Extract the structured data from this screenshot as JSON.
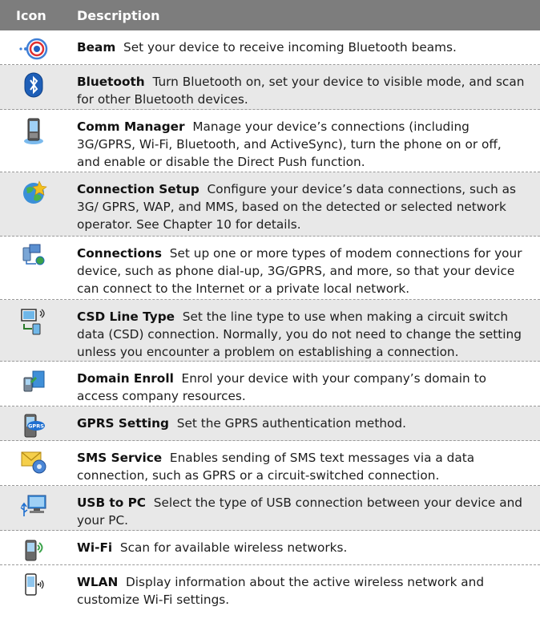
{
  "header": {
    "col_icon": "Icon",
    "col_description": "Description"
  },
  "rows": [
    {
      "name": "Beam",
      "desc": "Set your device to receive incoming Bluetooth beams.",
      "icon": "beam-icon"
    },
    {
      "name": "Bluetooth",
      "desc": "Turn Bluetooth on, set your device to visible mode, and scan for other Bluetooth devices.",
      "icon": "bluetooth-icon"
    },
    {
      "name": "Comm Manager",
      "desc": "Manage your device’s connections (including 3G/GPRS, Wi-Fi, Bluetooth, and ActiveSync), turn the phone on or off, and enable or disable the Direct Push function.",
      "icon": "comm-manager-icon"
    },
    {
      "name": "Connection Setup",
      "desc": "Configure your device’s data connections, such as 3G/ GPRS, WAP, and MMS, based on the detected or selected network operator. See Chapter 10 for details.",
      "icon": "connection-setup-icon"
    },
    {
      "name": "Connections",
      "desc": "Set up one or more types of modem connections for your device, such as phone dial-up, 3G/GPRS, and more, so that your device can connect to the Internet or a private local network.",
      "icon": "connections-icon"
    },
    {
      "name": "CSD Line Type",
      "desc": "Set  the line type to use when making a circuit switch data (CSD) connection. Normally, you do not need to change the setting unless you encounter a problem on establishing a connection.",
      "icon": "csd-line-type-icon"
    },
    {
      "name": "Domain Enroll",
      "desc": "Enrol your device with your company’s domain to access company resources.",
      "icon": "domain-enroll-icon"
    },
    {
      "name": "GPRS Setting",
      "desc": "Set the GPRS authentication method.",
      "icon": "gprs-setting-icon",
      "icon_label": "GPRS"
    },
    {
      "name": "SMS Service",
      "desc": "Enables sending of SMS text messages via a data connection, such as GPRS or a circuit-switched connection.",
      "icon": "sms-service-icon"
    },
    {
      "name": "USB to PC",
      "desc": "Select the type of USB connection between your device and your PC.",
      "icon": "usb-to-pc-icon"
    },
    {
      "name": "Wi-Fi",
      "desc": "Scan for available wireless networks.",
      "icon": "wifi-icon"
    },
    {
      "name": "WLAN",
      "desc": "Display information about the active wireless network and customize Wi-Fi settings.",
      "icon": "wlan-icon"
    }
  ]
}
